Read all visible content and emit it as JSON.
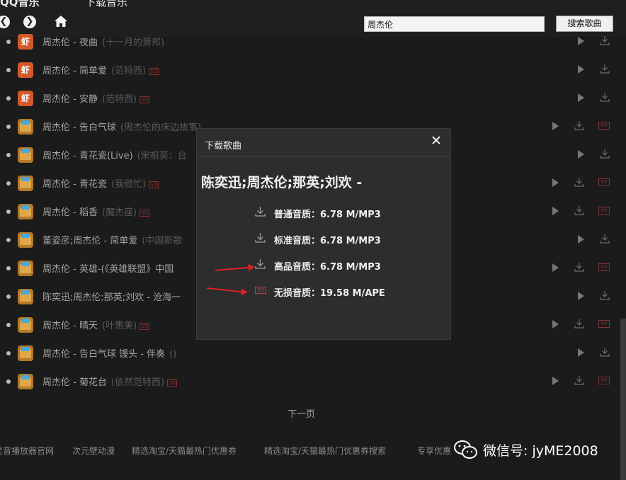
{
  "header": {
    "site_name": "QQ音乐",
    "site_sub": "下载音乐",
    "search_value": "周杰伦",
    "search_button": "搜索歌曲"
  },
  "songs": [
    {
      "source": "xia",
      "source_label": "虾",
      "text": "周杰伦 - 夜曲",
      "album": "(十一月的萧邦)",
      "sq": false,
      "mv": false,
      "play": true
    },
    {
      "source": "xia",
      "source_label": "虾",
      "text": "周杰伦 - 简单爱",
      "album": "(范特西)",
      "sq": true,
      "mv": false,
      "play": true
    },
    {
      "source": "xia",
      "source_label": "虾",
      "text": "周杰伦 - 安静",
      "album": "(范特西)",
      "sq": true,
      "mv": false,
      "play": true
    },
    {
      "source": "box",
      "source_label": "",
      "text": "周杰伦 - 告白气球",
      "album": "(周杰伦的床边故事)",
      "sq": false,
      "mv": true,
      "play": true
    },
    {
      "source": "box",
      "source_label": "",
      "text": "周杰伦 - 青花瓷(Live)",
      "album": "(宋祖英：台",
      "sq": false,
      "mv": false,
      "play": true
    },
    {
      "source": "box",
      "source_label": "",
      "text": "周杰伦 - 青花瓷",
      "album": "(我很忙)",
      "sq": true,
      "mv": true,
      "play": true
    },
    {
      "source": "box",
      "source_label": "",
      "text": "周杰伦 - 稻香",
      "album": "(魔杰座)",
      "sq": true,
      "mv": true,
      "play": true
    },
    {
      "source": "box",
      "source_label": "",
      "text": "董姿彦;周杰伦 - 简单爱",
      "album": "(中国新歌",
      "sq": false,
      "mv": false,
      "play": true
    },
    {
      "source": "box",
      "source_label": "",
      "text": "周杰伦 - 英雄-(《英雄联盟》中国",
      "album": "",
      "sq": false,
      "mv": true,
      "play": true
    },
    {
      "source": "box",
      "source_label": "",
      "text": "陈奕迅;周杰伦;那英;刘欢 - 沧海一",
      "album": "",
      "sq": false,
      "mv": false,
      "play": true
    },
    {
      "source": "box",
      "source_label": "",
      "text": "周杰伦 - 晴天",
      "album": "(叶惠美)",
      "sq": true,
      "mv": true,
      "play": true
    },
    {
      "source": "box",
      "source_label": "",
      "text": "周杰伦 - 告白气球 馒头 - 伴奏",
      "album": "()",
      "sq": false,
      "mv": false,
      "play": true
    },
    {
      "source": "box",
      "source_label": "",
      "text": "周杰伦 - 菊花台",
      "album": "(依然范特西)",
      "sq": true,
      "mv": true,
      "play": true
    }
  ],
  "pagination": {
    "next": "下一页"
  },
  "footer": {
    "links": [
      "灵音播放器官网",
      "次元壁动漫",
      "精选淘宝/天猫最热门优惠券",
      "精选淘宝/天猫最热门优惠券搜索",
      "专享优惠"
    ]
  },
  "watermark": {
    "text": "微信号: jyME2008"
  },
  "modal": {
    "title": "下载歌曲",
    "close": "✕",
    "song": "陈奕迅;周杰伦;那英;刘欢 -",
    "qualities": [
      {
        "icon": "download-icon",
        "label": "普通音质：6.78 M/MP3"
      },
      {
        "icon": "download-icon",
        "label": "标准音质：6.78 M/MP3"
      },
      {
        "icon": "download-icon",
        "label": "高品音质：6.78 M/MP3"
      },
      {
        "icon": "sq-icon",
        "label": "无损音质：19.58 M/APE"
      }
    ]
  },
  "colors": {
    "background": "#1b1b1b",
    "modal": "#2d2d2d",
    "arrow": "#e02020",
    "sq": "#8a2f2f"
  }
}
